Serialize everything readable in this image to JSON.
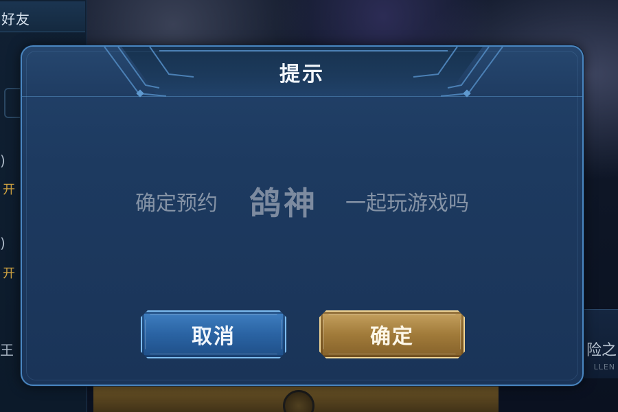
{
  "background": {
    "left_panel_title": "好友",
    "left_panel_paren_1": ")",
    "left_panel_gold_1": "开",
    "left_panel_paren_2": ")",
    "left_panel_gold_2": "开",
    "right_panel_text": "险之",
    "right_panel_subtext": "LLEN",
    "left_panel_bottom_text": "王"
  },
  "dialog": {
    "title": "提示",
    "message_prefix": "确定预约",
    "player_name": "鸽神",
    "message_suffix": "一起玩游戏吗",
    "cancel_label": "取消",
    "confirm_label": "确定"
  },
  "colors": {
    "dialog_bg": "#1d3a60",
    "dialog_border": "#4a86c0",
    "cancel_button": "#2a63a3",
    "confirm_button": "#a17b3a",
    "message_text": "#8593a6"
  }
}
